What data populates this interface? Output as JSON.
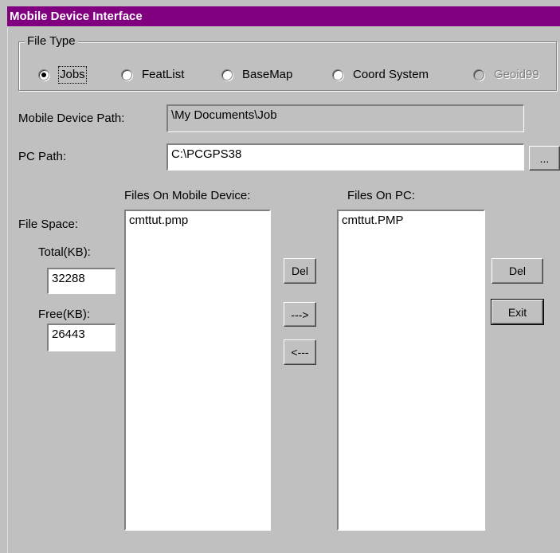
{
  "window": {
    "title": "Mobile Device Interface"
  },
  "file_type": {
    "legend": "File Type",
    "options": [
      {
        "label": "Jobs",
        "selected": true,
        "enabled": true
      },
      {
        "label": "FeatList",
        "selected": false,
        "enabled": true
      },
      {
        "label": "BaseMap",
        "selected": false,
        "enabled": true
      },
      {
        "label": "Coord System",
        "selected": false,
        "enabled": true
      },
      {
        "label": "Geoid99",
        "selected": false,
        "enabled": false
      }
    ]
  },
  "paths": {
    "mobile_label": "Mobile Device Path:",
    "mobile_value": "\\My Documents\\Job",
    "pc_label": "PC Path:",
    "pc_value": "C:\\PCGPS38",
    "browse_label": "..."
  },
  "file_space": {
    "label": "File Space:",
    "total_label": "Total(KB):",
    "total_value": "32288",
    "free_label": "Free(KB):",
    "free_value": "26443"
  },
  "mobile_files": {
    "header": "Files On Mobile Device:",
    "items": [
      "cmttut.pmp"
    ]
  },
  "pc_files": {
    "header": "Files On PC:",
    "items": [
      "cmttut.PMP"
    ]
  },
  "buttons": {
    "del_mobile": "Del",
    "copy_to_pc": "--->",
    "copy_to_mobile": "<---",
    "del_pc": "Del",
    "exit": "Exit"
  }
}
